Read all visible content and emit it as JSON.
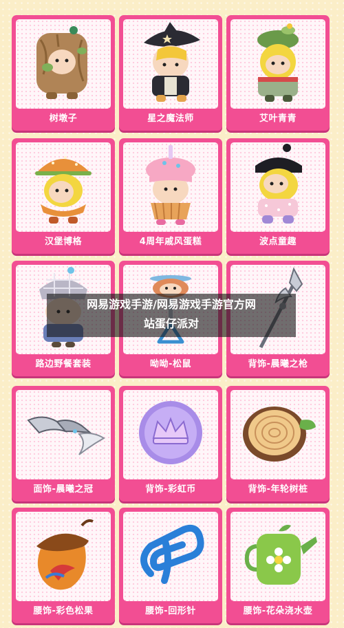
{
  "overlay": {
    "title_line1": "网易游戏手游/网易游戏手游官方网",
    "title_line2": "站蛋仔派对"
  },
  "cards": [
    {
      "label": "树墩子",
      "art": "tree-stump-costume-character"
    },
    {
      "label": "星之魔法师",
      "art": "star-wizard-character"
    },
    {
      "label": "艾叶青青",
      "art": "mugwort-girl-character"
    },
    {
      "label": "汉堡博格",
      "art": "hamburger-character"
    },
    {
      "label": "4周年戚风蛋糕",
      "art": "anniversary-cake-character"
    },
    {
      "label": "波点童趣",
      "art": "polka-dot-kid-character"
    },
    {
      "label": "路边野餐套装",
      "art": "picnic-outfit-character"
    },
    {
      "label": "呦呦-松鼠",
      "art": "squirrel-propeller-accessory"
    },
    {
      "label": "背饰-晨曦之枪",
      "art": "dawn-spear-accessory"
    },
    {
      "label": "面饰-晨曦之冠",
      "art": "dawn-crown-mask"
    },
    {
      "label": "背饰-彩虹币",
      "art": "rainbow-coin-accessory"
    },
    {
      "label": "背饰-年轮树桩",
      "art": "tree-ring-stump-accessory"
    },
    {
      "label": "腰饰-彩色松果",
      "art": "colorful-acorn-accessory"
    },
    {
      "label": "腰饰-回形针",
      "art": "paperclip-accessory"
    },
    {
      "label": "腰饰-花朵浇水壶",
      "art": "flower-watering-can-accessory"
    }
  ]
}
